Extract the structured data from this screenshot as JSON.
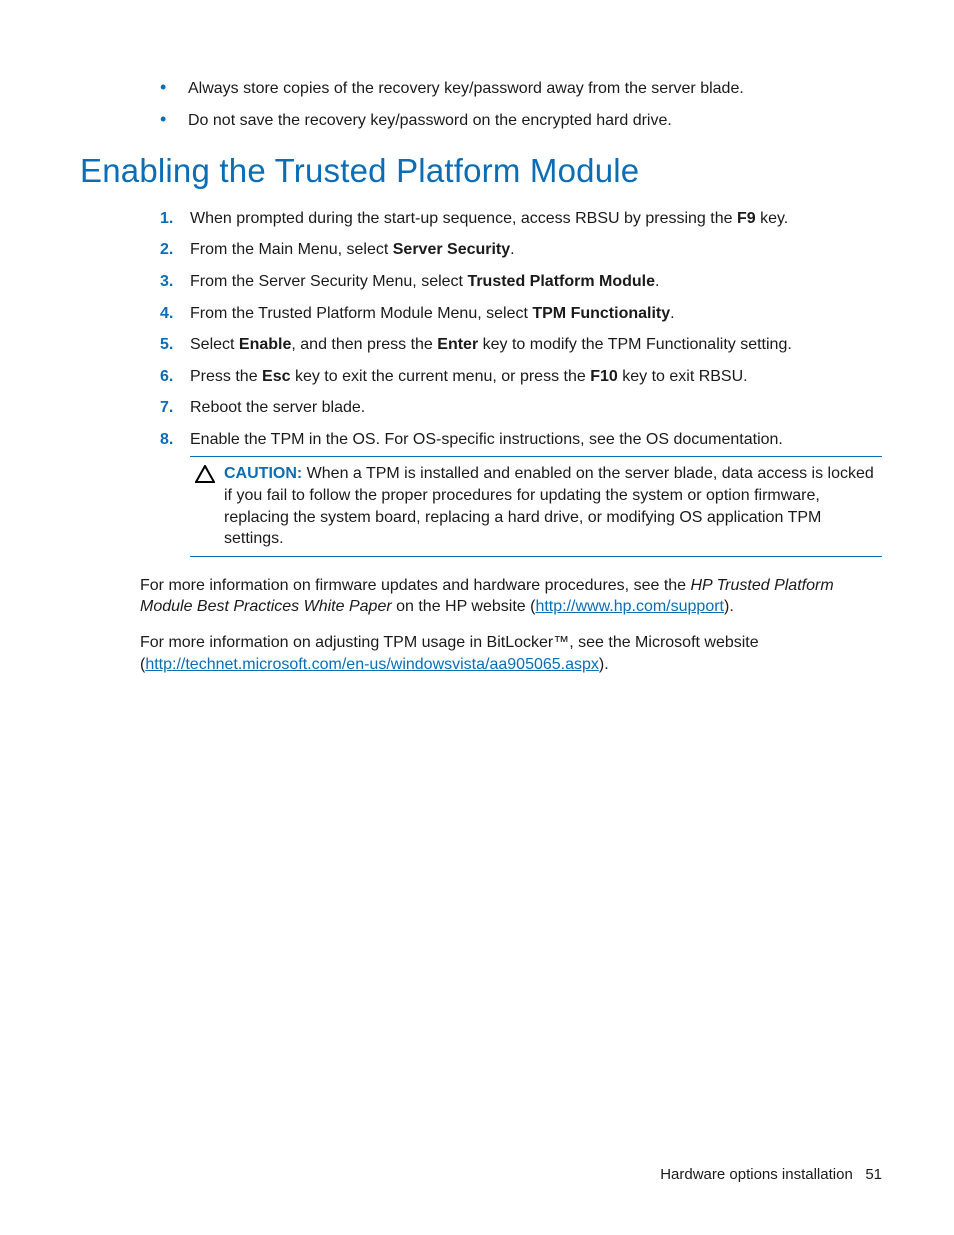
{
  "intro_bullets": [
    "Always store copies of the recovery key/password away from the server blade.",
    "Do not save the recovery key/password on the encrypted hard drive."
  ],
  "section_title": "Enabling the Trusted Platform Module",
  "steps": {
    "s1_a": "When prompted during the start-up sequence, access RBSU by pressing the ",
    "s1_b": "F9",
    "s1_c": " key.",
    "s2_a": "From the Main Menu, select ",
    "s2_b": "Server Security",
    "s2_c": ".",
    "s3_a": "From the Server Security Menu, select ",
    "s3_b": "Trusted Platform Module",
    "s3_c": ".",
    "s4_a": "From the Trusted Platform Module Menu, select ",
    "s4_b": "TPM Functionality",
    "s4_c": ".",
    "s5_a": "Select ",
    "s5_b": "Enable",
    "s5_c": ", and then press the ",
    "s5_d": "Enter",
    "s5_e": " key to modify the TPM Functionality setting.",
    "s6_a": "Press the ",
    "s6_b": "Esc",
    "s6_c": " key to exit the current menu, or press the ",
    "s6_d": "F10",
    "s6_e": " key to exit RBSU.",
    "s7": "Reboot the server blade.",
    "s8": "Enable the TPM in the OS. For OS-specific instructions, see the OS documentation."
  },
  "caution": {
    "label": "CAUTION:",
    "text": "  When a TPM is installed and enabled on the server blade, data access is locked if you fail to follow the proper procedures for updating the system or option firmware, replacing the system board, replacing a hard drive, or modifying OS application TPM settings."
  },
  "para1": {
    "a": "For more information on firmware updates and hardware procedures, see the ",
    "b": "HP Trusted Platform Module Best Practices White Paper",
    "c": " on the HP website (",
    "link": "http://www.hp.com/support",
    "d": ")."
  },
  "para2": {
    "a": "For more information on adjusting TPM usage in BitLocker™, see the Microsoft website (",
    "link": "http://technet.microsoft.com/en-us/windowsvista/aa905065.aspx",
    "b": ")."
  },
  "footer": {
    "section": "Hardware options installation",
    "page": "51"
  }
}
